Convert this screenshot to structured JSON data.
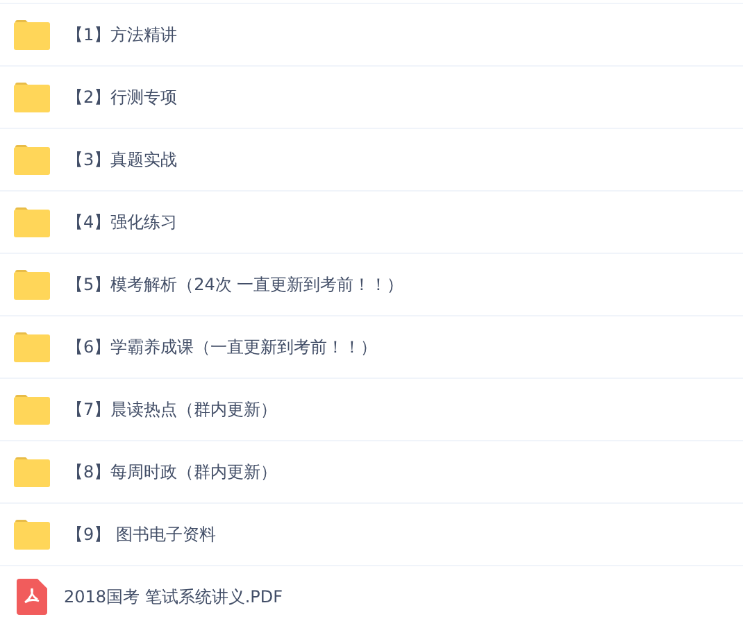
{
  "files": [
    {
      "kind": "folder",
      "name": "【1】方法精讲"
    },
    {
      "kind": "folder",
      "name": "【2】行测专项"
    },
    {
      "kind": "folder",
      "name": "【3】真题实战"
    },
    {
      "kind": "folder",
      "name": "【4】强化练习"
    },
    {
      "kind": "folder",
      "name": "【5】模考解析（24次 一直更新到考前！！）"
    },
    {
      "kind": "folder",
      "name": "【6】学霸养成课（一直更新到考前！！）"
    },
    {
      "kind": "folder",
      "name": "【7】晨读热点（群内更新）"
    },
    {
      "kind": "folder",
      "name": "【8】每周时政（群内更新）"
    },
    {
      "kind": "folder",
      "name": "【9】 图书电子资料"
    },
    {
      "kind": "pdf",
      "name": "2018国考 笔试系统讲义.PDF"
    }
  ]
}
